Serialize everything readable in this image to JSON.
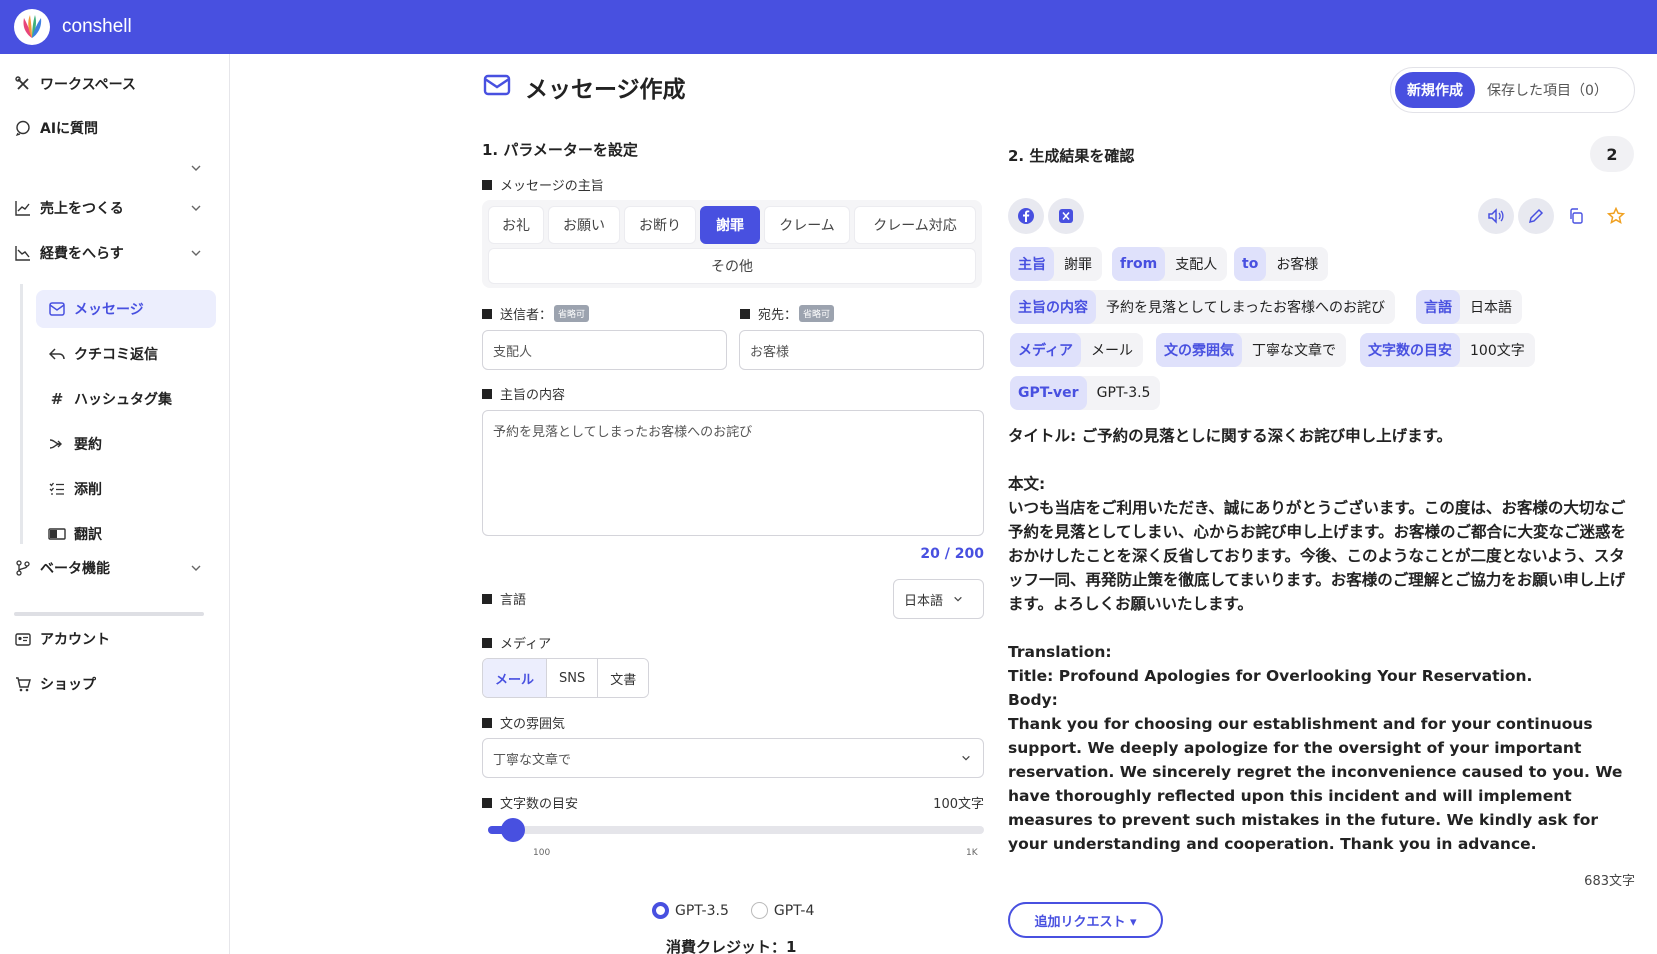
{
  "app": {
    "brand": "conshell"
  },
  "sidebar": {
    "workspace": "ワークスペース",
    "ask_ai": "AIに質問",
    "sales": "売上をつくる",
    "cost": "経費をへらす",
    "sub_items": [
      {
        "label": "メッセージ"
      },
      {
        "label": "クチコミ返信"
      },
      {
        "label": "ハッシュタグ集"
      },
      {
        "label": "要約"
      },
      {
        "label": "添削"
      },
      {
        "label": "翻訳"
      }
    ],
    "beta": "ベータ機能",
    "account": "アカウント",
    "shop": "ショップ"
  },
  "header": {
    "title": "メッセージ作成",
    "tab_new": "新規作成",
    "tab_saved": "保存した項目（0）"
  },
  "params": {
    "section_title": "1. パラメーターを設定",
    "purpose_label": "メッセージの主旨",
    "purpose_options": [
      "お礼",
      "お願い",
      "お断り",
      "謝罪",
      "クレーム",
      "クレーム対応",
      "その他"
    ],
    "sender_label": "送信者：",
    "recipient_label": "宛先：",
    "optional_badge": "省略可",
    "sender_value": "支配人",
    "recipient_value": "お客様",
    "content_label": "主旨の内容",
    "content_value": "予約を見落としてしまったお客様へのお詫び",
    "counter": "20 / 200",
    "language_label": "言語",
    "language_value": "日本語",
    "media_label": "メディア",
    "media_options": [
      "メール",
      "SNS",
      "文書"
    ],
    "tone_label": "文の雰囲気",
    "tone_value": "丁寧な文章で",
    "length_label": "文字数の目安",
    "length_value": "100文字",
    "slider_min": "100",
    "slider_max": "1K",
    "slider_fraction": 0.05,
    "model_a": "GPT-3.5",
    "model_b": "GPT-4",
    "credit": "消費クレジット：1"
  },
  "result": {
    "section_title": "2. 生成結果を確認",
    "count": "2",
    "chips": [
      {
        "k": "主旨",
        "v": "謝罪"
      },
      {
        "k": "from",
        "v": "支配人"
      },
      {
        "k": "to",
        "v": "お客様"
      },
      {
        "k": "主旨の内容",
        "v": "予約を見落としてしまったお客様へのお詫び"
      },
      {
        "k": "言語",
        "v": "日本語"
      },
      {
        "k": "メディア",
        "v": "メール"
      },
      {
        "k": "文の雰囲気",
        "v": "丁寧な文章で"
      },
      {
        "k": "文字数の目安",
        "v": "100文字"
      },
      {
        "k": "GPT-ver",
        "v": "GPT-3.5"
      }
    ],
    "body": "タイトル: ご予約の見落としに関する深くお詫び申し上げます。\n\n本文:\nいつも当店をご利用いただき、誠にありがとうございます。この度は、お客様の大切なご予約を見落としてしまい、心からお詫び申し上げます。お客様のご都合に大変なご迷惑をおかけしたことを深く反省しております。今後、このようなことが二度とないよう、スタッフ一同、再発防止策を徹底してまいります。お客様のご理解とご協力をお願い申し上げます。よろしくお願いいたします。\n\nTranslation:\nTitle: Profound Apologies for Overlooking Your Reservation.\nBody:\nThank you for choosing our establishment and for your continuous support. We deeply apologize for the oversight of your important reservation. We sincerely regret the inconvenience caused to you. We have thoroughly reflected upon this incident and will implement measures to prevent such mistakes in the future. We kindly ask for your understanding and cooperation. Thank you in advance.",
    "char_total": "683文字",
    "request_button": "追加リクエスト ▾"
  },
  "colors": {
    "accent": "#4850e0",
    "accent_light": "#dfe1fb",
    "star": "#f0a020"
  }
}
